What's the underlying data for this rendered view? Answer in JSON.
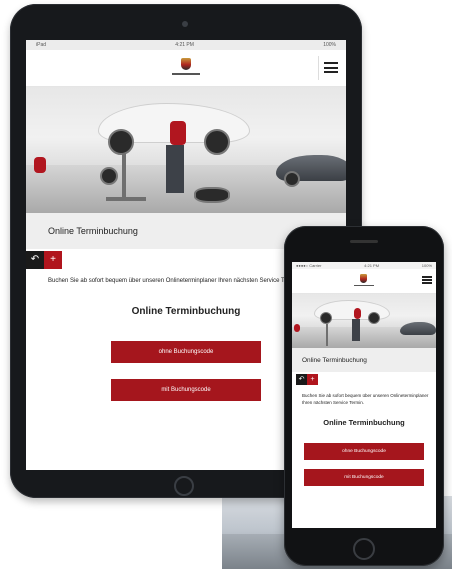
{
  "tablet": {
    "status_left": "iPad",
    "status_time": "4:21 PM",
    "status_right": "100%",
    "section_title": "Online Terminbuchung",
    "nav_back_icon": "back-arrow-icon",
    "nav_plus_icon": "plus-icon",
    "intro_text": "Buchen Sie ab sofort bequem über unseren Onlineterminplaner Ihren nächsten Service Termin.",
    "form_title": "Online Terminbuchung",
    "cta_without_code": "ohne Buchungscode",
    "cta_with_code": "mit Buchungscode"
  },
  "phone": {
    "status_left": "●●●●○ Carrier",
    "status_time": "4:21 PM",
    "status_right": "100%",
    "section_title": "Online Terminbuchung",
    "intro_text": "Buchen Sie ab sofort bequem über unseren Onlineterminplaner Ihren nächsten Service Termin.",
    "form_title": "Online Terminbuchung",
    "cta_without_code": "ohne Buchungscode",
    "cta_with_code": "mit Buchungscode"
  },
  "colors": {
    "accent_red": "#a5161d",
    "dark_button": "#1a1a1a",
    "section_bg": "#eeeeee"
  }
}
